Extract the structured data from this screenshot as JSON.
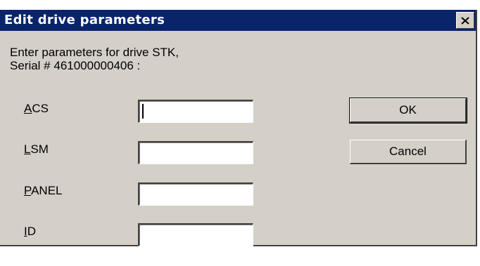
{
  "dialog": {
    "title": "Edit drive parameters",
    "close_label": "×",
    "instruction_line1": "Enter parameters for drive STK,",
    "instruction_line2": "Serial # 461000000406 :"
  },
  "fields": [
    {
      "mnemonic": "A",
      "rest": "CS",
      "value": "",
      "placeholder": ""
    },
    {
      "mnemonic": "L",
      "rest": "SM",
      "value": "",
      "placeholder": ""
    },
    {
      "mnemonic": "P",
      "rest": "ANEL",
      "value": "",
      "placeholder": ""
    },
    {
      "mnemonic": "I",
      "rest": "D",
      "value": "",
      "placeholder": ""
    }
  ],
  "buttons": {
    "ok": "OK",
    "cancel": "Cancel"
  },
  "colors": {
    "titlebar": "#0a246a",
    "face": "#d4d0c8"
  },
  "icons": {
    "close": "close-icon"
  }
}
